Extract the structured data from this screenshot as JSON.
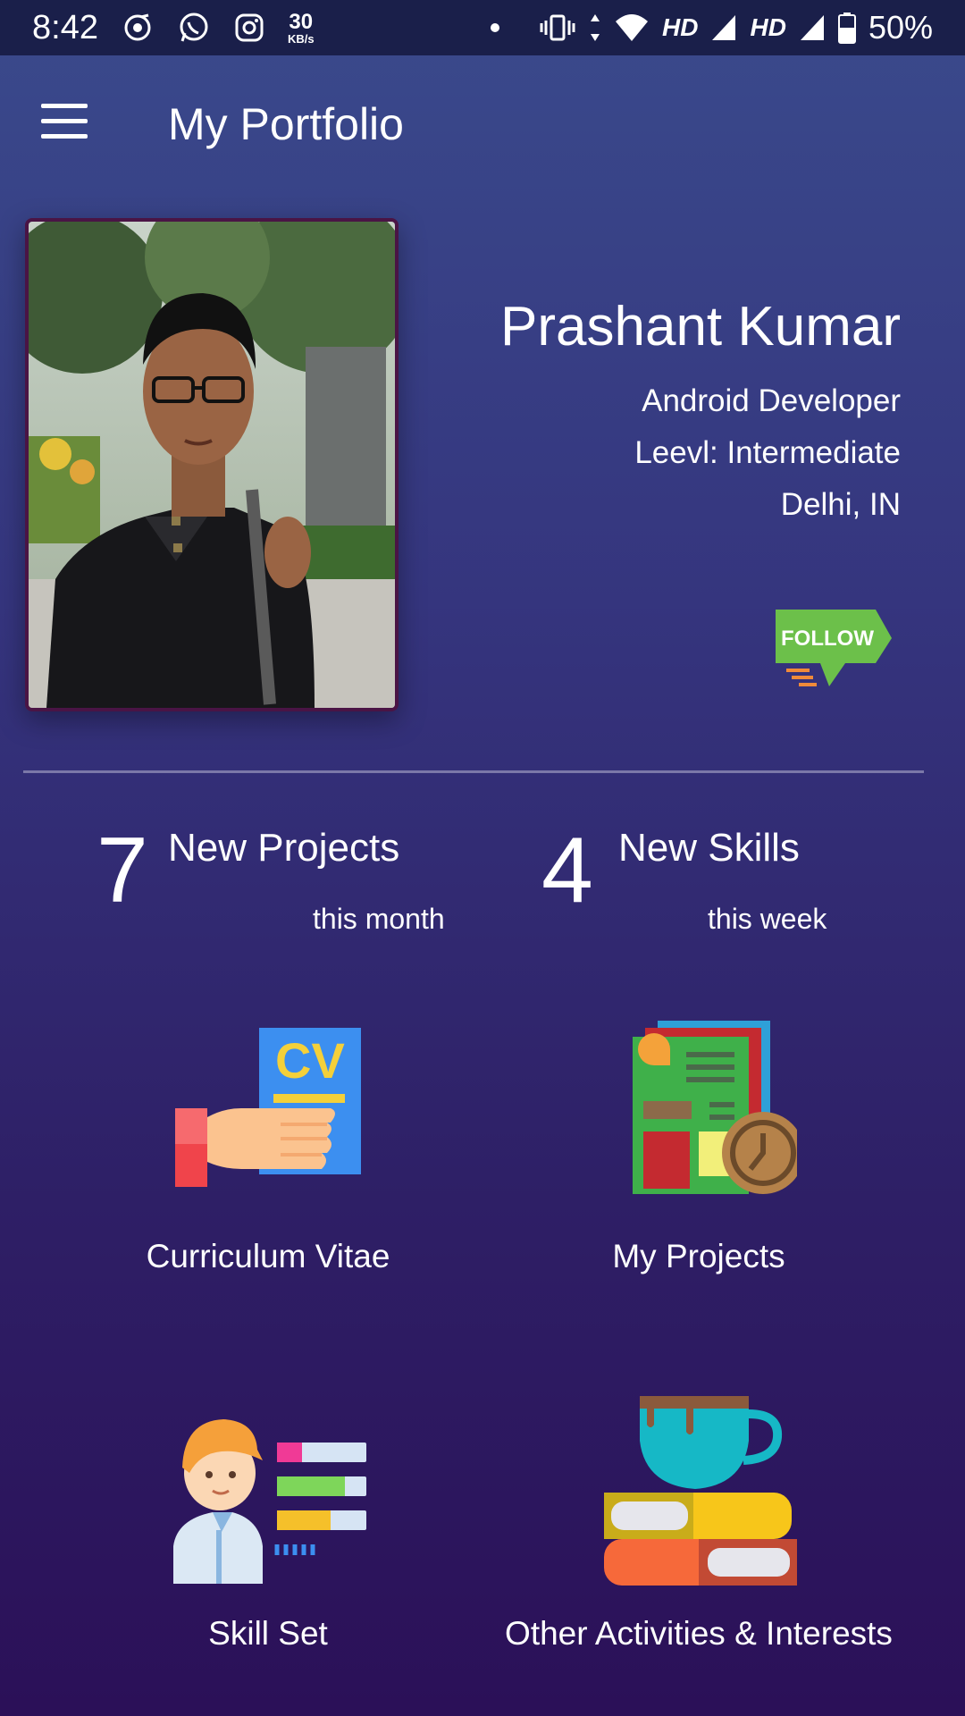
{
  "status_bar": {
    "time": "8:42",
    "net_speed_value": "30",
    "net_speed_unit": "KB/s",
    "hd1": "HD",
    "hd2": "HD",
    "battery": "50%"
  },
  "app_bar": {
    "title": "My Portfolio",
    "menu_icon": "hamburger-menu-icon"
  },
  "profile": {
    "name": "Prashant Kumar",
    "role": "Android Developer",
    "level": "Leevl: Intermediate",
    "location": "Delhi, IN",
    "follow_label": "FOLLOW"
  },
  "stats": [
    {
      "number": "7",
      "label": "New Projects",
      "period": "this month"
    },
    {
      "number": "4",
      "label": "New Skills",
      "period": "this week"
    }
  ],
  "tiles": [
    {
      "label": "Curriculum Vitae",
      "icon": "cv-hand-icon"
    },
    {
      "label": "My Projects",
      "icon": "projects-icon"
    },
    {
      "label": "Skill Set",
      "icon": "skill-set-icon"
    },
    {
      "label": "Other Activities & Interests",
      "icon": "coffee-books-icon"
    }
  ],
  "colors": {
    "status_bar_bg": "#1a1f4a",
    "bg_top": "#3a4a8c",
    "bg_bottom": "#2b1058",
    "follow_green": "#6cc04a",
    "photo_border": "#4a1445"
  }
}
